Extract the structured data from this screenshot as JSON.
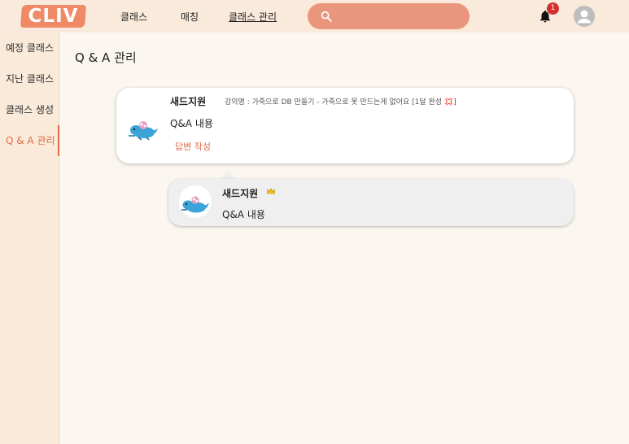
{
  "header": {
    "logo": "CLIV",
    "nav": [
      {
        "label": "클래스"
      },
      {
        "label": "매칭"
      },
      {
        "label": "클래스 관리"
      }
    ],
    "search": {
      "value": "",
      "placeholder": ""
    },
    "notifications": {
      "count": "1"
    }
  },
  "sidebar": {
    "items": [
      {
        "label": "예정 클래스"
      },
      {
        "label": "지난 클래스"
      },
      {
        "label": "클래스 생성"
      },
      {
        "label": "Q & A 관리"
      }
    ]
  },
  "main": {
    "title": "Q & A 관리",
    "question": {
      "author": "새드지원",
      "lecture_prefix": "강의명 : 가죽으로 DB 만들기 - 가죽으로 못 만드는게 없어요 [1달 완성 ",
      "lecture_emoji": "💢",
      "lecture_suffix": "]",
      "content": "Q&A 내용",
      "reply_label": "답변 작성"
    },
    "answer": {
      "author": "새드지원",
      "content": "Q&A 내용"
    }
  },
  "colors": {
    "brand": "#ef8a67",
    "accent": "#e26c48",
    "header_bg": "#faeadb",
    "search_bg": "#e9967c",
    "badge": "#d32f2f"
  }
}
